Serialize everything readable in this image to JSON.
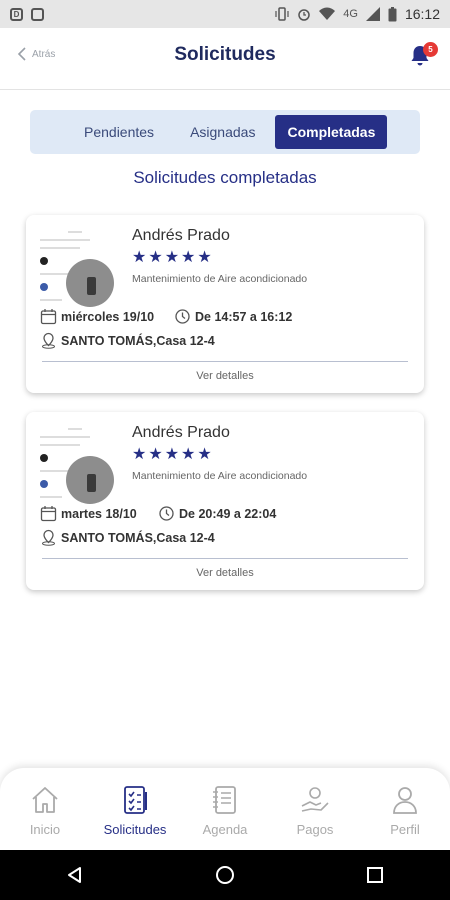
{
  "statusbar": {
    "time": "16:12",
    "network": "4G"
  },
  "header": {
    "back_label": "Atrás",
    "title": "Solicitudes",
    "notification_count": "5"
  },
  "tabs": [
    {
      "label": "Pendientes",
      "active": false
    },
    {
      "label": "Asignadas",
      "active": false
    },
    {
      "label": "Completadas",
      "active": true
    }
  ],
  "subtitle": "Solicitudes completadas",
  "requests": [
    {
      "name": "Andrés Prado",
      "rating": 5,
      "stars": "★★★★★",
      "service": "Mantenimiento de Aire acondicionado",
      "date": "miércoles 19/10",
      "time": "De 14:57 a 16:12",
      "address": "SANTO TOMÁS,Casa 12-4",
      "details_label": "Ver detalles"
    },
    {
      "name": "Andrés Prado",
      "rating": 5,
      "stars": "★★★★★",
      "service": "Mantenimiento de Aire acondicionado",
      "date": "martes 18/10",
      "time": "De 20:49 a 22:04",
      "address": "SANTO TOMÁS,Casa 12-4",
      "details_label": "Ver detalles"
    }
  ],
  "bottom_nav": [
    {
      "label": "Inicio",
      "icon": "home-icon",
      "active": false
    },
    {
      "label": "Solicitudes",
      "icon": "checklist-icon",
      "active": true
    },
    {
      "label": "Agenda",
      "icon": "notebook-icon",
      "active": false
    },
    {
      "label": "Pagos",
      "icon": "payment-icon",
      "active": false
    },
    {
      "label": "Perfil",
      "icon": "user-icon",
      "active": false
    }
  ],
  "colors": {
    "primary": "#262f86",
    "tab_bg": "#dfe9f6",
    "badge": "#e53935",
    "inactive": "#aaaaaa"
  }
}
